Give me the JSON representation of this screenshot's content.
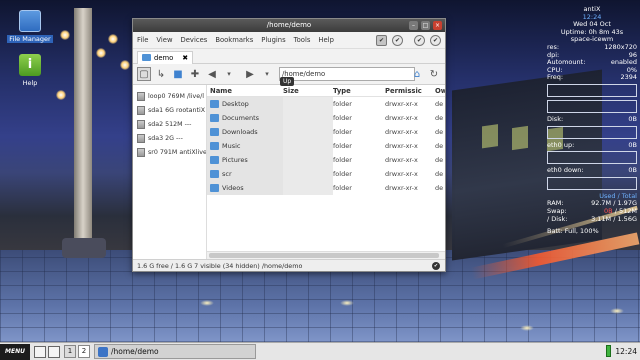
{
  "desktop": {
    "icons": [
      {
        "label": "File Manager",
        "icon": "file-manager-icon"
      },
      {
        "label": "Help",
        "icon": "help-icon"
      }
    ]
  },
  "conky": {
    "distro": "antiX",
    "time": "12:24",
    "date": "Wed 04 Oct",
    "uptime": "Uptime: 0h 8m 43s",
    "wm": "space-icewm",
    "stats": [
      {
        "label": "res:",
        "value": "1280x720"
      },
      {
        "label": "dpi:",
        "value": "96"
      },
      {
        "label": "Automount:",
        "value": "enabled"
      },
      {
        "label": "CPU:",
        "value": "0%"
      },
      {
        "label": "Freq:",
        "value": "2394"
      }
    ],
    "disk": {
      "label": "Disk:",
      "value": "0B"
    },
    "eth0_up": {
      "label": "eth0 up:",
      "value": "0B"
    },
    "eth0_down": {
      "label": "eth0 down:",
      "value": "0B"
    },
    "mem_header": "Used / Total",
    "mem": [
      {
        "label": "RAM:",
        "value": "92.7M / 1.97G"
      },
      {
        "label": "Swap:",
        "used": "0B",
        "total": "/ 512M"
      },
      {
        "label": "/ Disk:",
        "value": "3.11M / 1.56G"
      }
    ],
    "battery": "Batt: Full, 100%"
  },
  "window": {
    "title": "/home/demo",
    "menu": [
      "File",
      "View",
      "Devices",
      "Bookmarks",
      "Plugins",
      "Tools",
      "Help"
    ],
    "tab_label": "demo",
    "path": "/home/demo",
    "tooltip": "Up",
    "devices": [
      "loop0 769M /live/l",
      "sda1 6G rootantiX",
      "sda2 512M ---",
      "sda3 2G ---",
      "sr0 791M antiXlive"
    ],
    "columns": {
      "name": "Name",
      "size": "Size",
      "type": "Type",
      "perm": "Permissic",
      "owner": "Ow"
    },
    "files": [
      {
        "name": "Desktop",
        "type": "folder",
        "perm": "drwxr-xr-x",
        "owner": "de"
      },
      {
        "name": "Documents",
        "type": "folder",
        "perm": "drwxr-xr-x",
        "owner": "de"
      },
      {
        "name": "Downloads",
        "type": "folder",
        "perm": "drwxr-xr-x",
        "owner": "de"
      },
      {
        "name": "Music",
        "type": "folder",
        "perm": "drwxr-xr-x",
        "owner": "de"
      },
      {
        "name": "Pictures",
        "type": "folder",
        "perm": "drwxr-xr-x",
        "owner": "de"
      },
      {
        "name": "scr",
        "type": "folder",
        "perm": "drwxr-xr-x",
        "owner": "de"
      },
      {
        "name": "Videos",
        "type": "folder",
        "perm": "drwxr-xr-x",
        "owner": "de"
      }
    ],
    "status": "1.6 G free / 1.6 G   7 visible (34 hidden)   /home/demo"
  },
  "taskbar": {
    "menu_label": "MENU",
    "workspaces": [
      "1",
      "2"
    ],
    "task_label": "/home/demo",
    "clock": "12:24"
  }
}
